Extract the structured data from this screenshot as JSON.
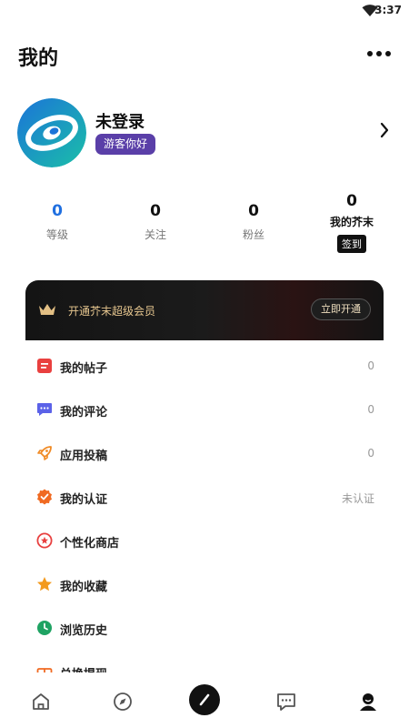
{
  "status_bar": {
    "time": "3:37"
  },
  "header": {
    "title": "我的"
  },
  "profile": {
    "name": "未登录",
    "badge": "游客你好"
  },
  "stats": [
    {
      "value": "0",
      "label": "等级"
    },
    {
      "value": "0",
      "label": "关注"
    },
    {
      "value": "0",
      "label": "粉丝"
    }
  ],
  "mustard": {
    "value": "0",
    "label": "我的芥末",
    "button": "签到"
  },
  "vip": {
    "text": "开通芥末超级会员",
    "button": "立即开通"
  },
  "menu": [
    {
      "label": "我的帖子",
      "value": "0"
    },
    {
      "label": "我的评论",
      "value": "0"
    },
    {
      "label": "应用投稿",
      "value": "0"
    },
    {
      "label": "我的认证",
      "value": "未认证"
    },
    {
      "label": "个性化商店",
      "value": ""
    },
    {
      "label": "我的收藏",
      "value": ""
    },
    {
      "label": "浏览历史",
      "value": ""
    },
    {
      "label": "兑换提现",
      "value": ""
    }
  ],
  "tabs": [
    "home-icon",
    "discover-icon",
    "publish-icon",
    "message-icon",
    "profile-icon"
  ]
}
